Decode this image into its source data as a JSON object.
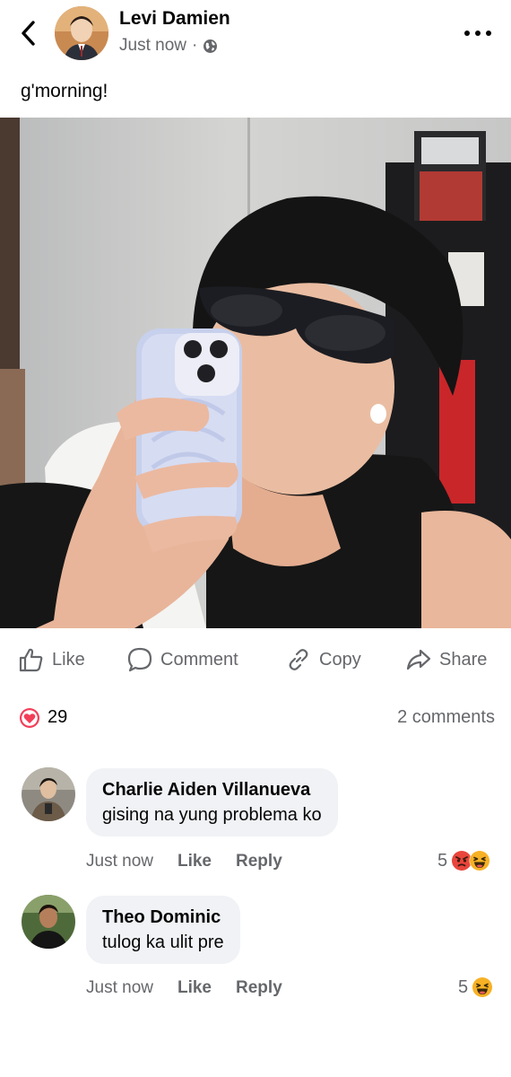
{
  "post": {
    "author": "Levi Damien",
    "time": "Just now",
    "separator": "·",
    "text": "g'morning!"
  },
  "actions": {
    "like": "Like",
    "comment": "Comment",
    "copy": "Copy",
    "share": "Share"
  },
  "stats": {
    "reaction_count": "29",
    "comments": "2 comments"
  },
  "comments": [
    {
      "name": "Charlie Aiden Villanueva",
      "text": "gising na yung problema ko",
      "time": "Just now",
      "like": "Like",
      "reply": "Reply",
      "reaction_count": "5",
      "reactions": [
        "angry-emoji",
        "haha-emoji"
      ]
    },
    {
      "name": "Theo Dominic",
      "text": "tulog ka ulit pre",
      "time": "Just now",
      "like": "Like",
      "reply": "Reply",
      "reaction_count": "5",
      "reactions": [
        "haha-emoji"
      ]
    }
  ],
  "colors": {
    "secondary_text": "#65676b",
    "bubble_bg": "#f0f2f5",
    "love_red": "#f33e58",
    "emoji_yellow": "#f7b125",
    "angry_red": "#e9453b"
  }
}
